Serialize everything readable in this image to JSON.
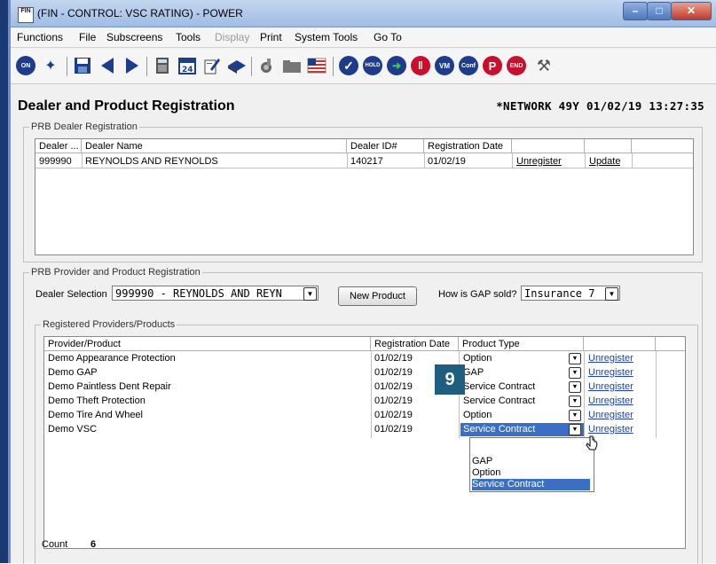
{
  "window": {
    "title": "(FIN - CONTROL: VSC RATING) - POWER",
    "app_icon": "FIN"
  },
  "menu": [
    "Functions",
    "File",
    "Subscreens",
    "Tools",
    "Display",
    "Print",
    "System Tools",
    "Go To"
  ],
  "toolbar": {
    "icons": [
      "on-icon",
      "compass-icon",
      "save-icon",
      "back-icon",
      "forward-icon",
      "calculator-icon",
      "calendar-icon",
      "notepad-icon",
      "book-icon",
      "rocket-icon",
      "folder-icon",
      "flag-icon",
      "check-icon",
      "hold-icon",
      "go-arrow-icon",
      "stop-icon",
      "vm-icon",
      "conf-icon",
      "print-p-icon",
      "end-icon",
      "tools-icon"
    ],
    "labels": {
      "on": "ON",
      "hold": "HOLD",
      "vm": "VM",
      "conf": "Conf",
      "p": "P",
      "end": "END"
    }
  },
  "page": {
    "title": "Dealer and Product Registration",
    "status": "*NETWORK 49Y 01/02/19 13:27:35"
  },
  "dealer_section": {
    "legend": "PRB Dealer Registration",
    "headers": [
      "Dealer ...",
      "Dealer Name",
      "Dealer ID#",
      "Registration Date"
    ],
    "row": {
      "dealer": "999990",
      "name": "REYNOLDS AND REYNOLDS",
      "dealer_id": "140217",
      "reg_date": "01/02/19",
      "unregister": "Unregister",
      "update": "Update"
    }
  },
  "provider_section": {
    "legend": "PRB Provider and Product Registration",
    "dealer_selection_label": "Dealer Selection",
    "dealer_selection_value": "999990 - REYNOLDS AND REYN",
    "new_product_button": "New Product",
    "gap_label": "How is GAP sold?",
    "gap_value": "Insurance 7",
    "registered_legend": "Registered Providers/Products",
    "headers": [
      "Provider/Product",
      "Registration Date",
      "Product Type"
    ],
    "rows": [
      {
        "product": "Demo Appearance Protection",
        "date": "01/02/19",
        "type": "Option",
        "link": "Unregister"
      },
      {
        "product": "Demo GAP",
        "date": "01/02/19",
        "type": "GAP",
        "link": "Unregister"
      },
      {
        "product": "Demo Paintless Dent Repair",
        "date": "01/02/19",
        "type": "Service Contract",
        "link": "Unregister"
      },
      {
        "product": "Demo Theft Protection",
        "date": "01/02/19",
        "type": "Service Contract",
        "link": "Unregister"
      },
      {
        "product": "Demo Tire And Wheel",
        "date": "01/02/19",
        "type": "Option",
        "link": "Unregister"
      },
      {
        "product": "Demo VSC",
        "date": "01/02/19",
        "type": "Service Contract",
        "link": "Unregister"
      }
    ],
    "dropdown_options": [
      "GAP",
      "Option",
      "Service Contract"
    ],
    "count_label": "Count",
    "count_value": "6"
  },
  "callout": {
    "number": "9",
    "color": "#1f5e7e"
  },
  "colors": {
    "selection": "#3b6fc4",
    "link": "#1a3fbf",
    "title_bar": "#9fbce4"
  }
}
